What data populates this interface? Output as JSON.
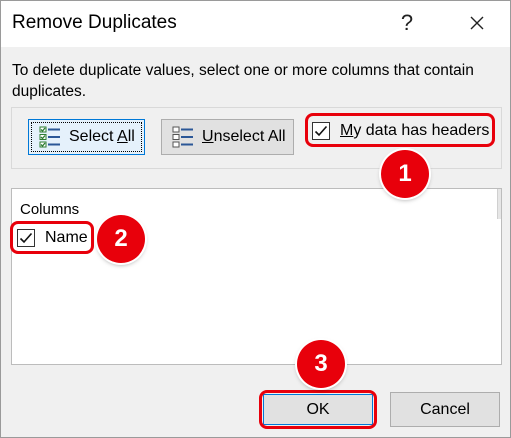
{
  "dialog": {
    "title": "Remove Duplicates",
    "help_label": "?",
    "close_label": "✕",
    "description": "To delete duplicate values, select one or more columns that contain duplicates."
  },
  "toolbar": {
    "select_all_pre": "Select ",
    "select_all_underlined": "A",
    "select_all_post": "ll",
    "unselect_all_underlined": "U",
    "unselect_all_post": "nselect All",
    "headers_underlined": "M",
    "headers_post": "y data has headers",
    "headers_checked": true
  },
  "columns": {
    "header": "Columns",
    "items": [
      {
        "label": "Name",
        "checked": true
      }
    ]
  },
  "footer": {
    "ok_label": "OK",
    "cancel_label": "Cancel"
  },
  "callouts": {
    "badge_1": "1",
    "badge_2": "2",
    "badge_3": "3"
  },
  "colors": {
    "highlight": "#e8000b",
    "focus_border": "#0078d7"
  },
  "icons": {
    "select_all": "select-all-icon",
    "unselect_all": "unselect-all-icon",
    "check": "checkmark-icon"
  }
}
